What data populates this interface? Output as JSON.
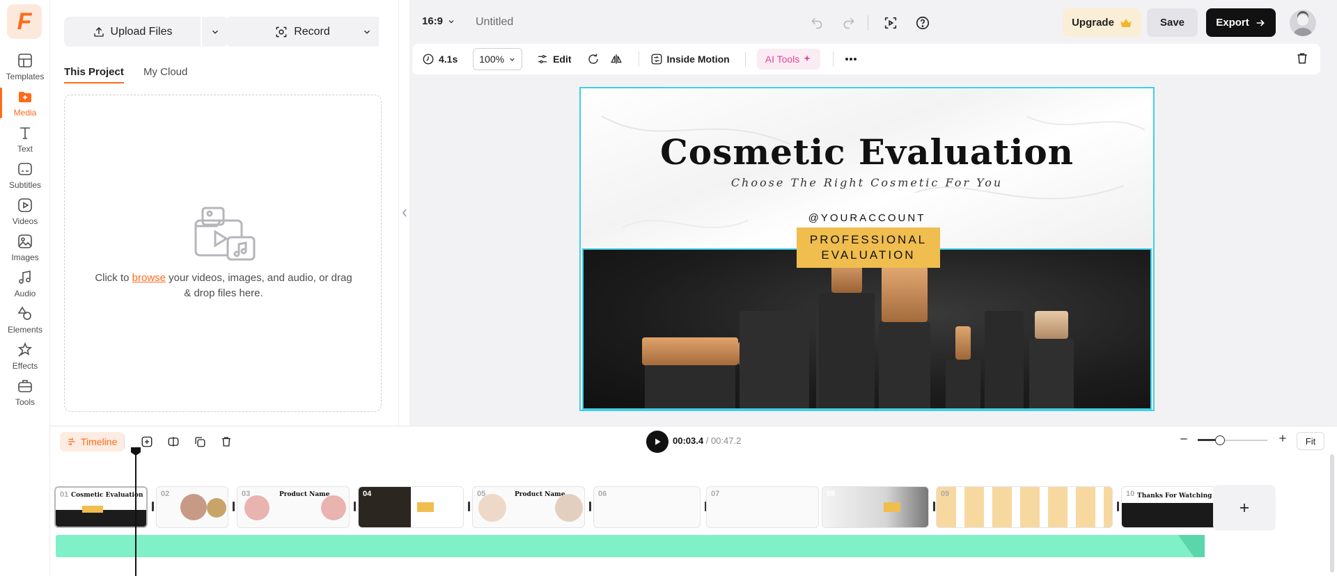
{
  "brand": {
    "logo_letter": "F",
    "accent": "#ff6a1a"
  },
  "rail": {
    "items": [
      {
        "label": "Templates",
        "icon": "templates-icon"
      },
      {
        "label": "Media",
        "icon": "media-icon",
        "active": true
      },
      {
        "label": "Text",
        "icon": "text-icon"
      },
      {
        "label": "Subtitles",
        "icon": "subtitles-icon"
      },
      {
        "label": "Videos",
        "icon": "videos-icon"
      },
      {
        "label": "Images",
        "icon": "images-icon"
      },
      {
        "label": "Audio",
        "icon": "audio-icon"
      },
      {
        "label": "Elements",
        "icon": "elements-icon"
      },
      {
        "label": "Effects",
        "icon": "effects-icon"
      },
      {
        "label": "Tools",
        "icon": "tools-icon"
      }
    ]
  },
  "media_panel": {
    "upload_label": "Upload Files",
    "record_label": "Record",
    "tabs": [
      {
        "label": "This Project",
        "active": true
      },
      {
        "label": "My Cloud",
        "active": false
      }
    ],
    "drop_prefix": "Click to ",
    "drop_link": "browse",
    "drop_suffix": " your videos, images, and audio, or drag & drop files here."
  },
  "topbar": {
    "aspect_ratio": "16:9",
    "doc_title": "Untitled",
    "upgrade_label": "Upgrade",
    "save_label": "Save",
    "export_label": "Export"
  },
  "toolbar": {
    "duration": "4.1s",
    "zoom": "100%",
    "edit_label": "Edit",
    "inside_motion_label": "Inside Motion",
    "ai_tools_label": "AI Tools"
  },
  "slide": {
    "title": "Cosmetic Evaluation",
    "subtitle": "Choose The Right Cosmetic For You",
    "account": "@YOURACCOUNT",
    "badge_line1": "PROFESSIONAL",
    "badge_line2": "EVALUATION",
    "badge_color": "#f0bd4f",
    "selection_color": "#3fd0e6"
  },
  "timeline": {
    "label": "Timeline",
    "current_time": "00:03.4",
    "separator": " / ",
    "total_time": "00:47.2",
    "fit_label": "Fit",
    "zoom_level": 0.32,
    "clips": [
      {
        "num": "01",
        "caption": "Cosmetic Evaluation"
      },
      {
        "num": "02",
        "caption": ""
      },
      {
        "num": "03",
        "caption": "Product Name"
      },
      {
        "num": "04",
        "caption": ""
      },
      {
        "num": "05",
        "caption": "Product Name"
      },
      {
        "num": "06",
        "caption": ""
      },
      {
        "num": "07",
        "caption": ""
      },
      {
        "num": "08",
        "caption": ""
      },
      {
        "num": "09",
        "caption": ""
      },
      {
        "num": "10",
        "caption": "Thanks For Watching"
      }
    ],
    "audio_color": "#7ff0c8"
  }
}
